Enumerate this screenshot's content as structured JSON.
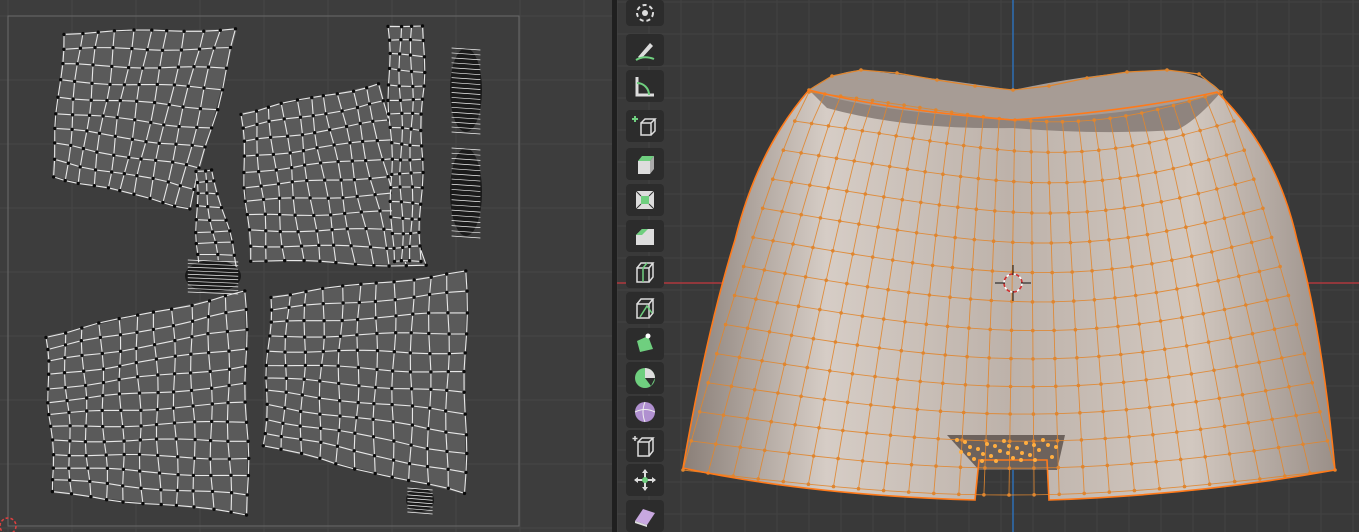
{
  "uv_editor": {
    "grid_color": "#464646",
    "bounds_color": "#6a6a6a",
    "island_fill": "#5a5a5a",
    "edge_color": "#e8e8e8",
    "vertex_color": "#0a0a0a"
  },
  "viewport": {
    "background": "#393939",
    "mesh_fill": "#c9bfb7",
    "wire_color": "#e0862f",
    "x_axis_color": "#b0383e",
    "z_axis_color": "#2d6fb6"
  },
  "toolbar": {
    "tools": [
      {
        "icon": "cursor-icon"
      },
      {
        "icon": "annotate-icon"
      },
      {
        "icon": "measure-icon"
      },
      {
        "icon": "add-cube-icon"
      },
      {
        "icon": "extrude-region-icon"
      },
      {
        "icon": "inset-faces-icon"
      },
      {
        "icon": "bevel-icon"
      },
      {
        "icon": "loop-cut-icon"
      },
      {
        "icon": "knife-icon"
      },
      {
        "icon": "poly-build-icon"
      },
      {
        "icon": "spin-icon"
      },
      {
        "icon": "smooth-vertices-icon"
      },
      {
        "icon": "edge-slide-icon"
      },
      {
        "icon": "shrink-fatten-icon"
      },
      {
        "icon": "shear-icon"
      }
    ]
  }
}
